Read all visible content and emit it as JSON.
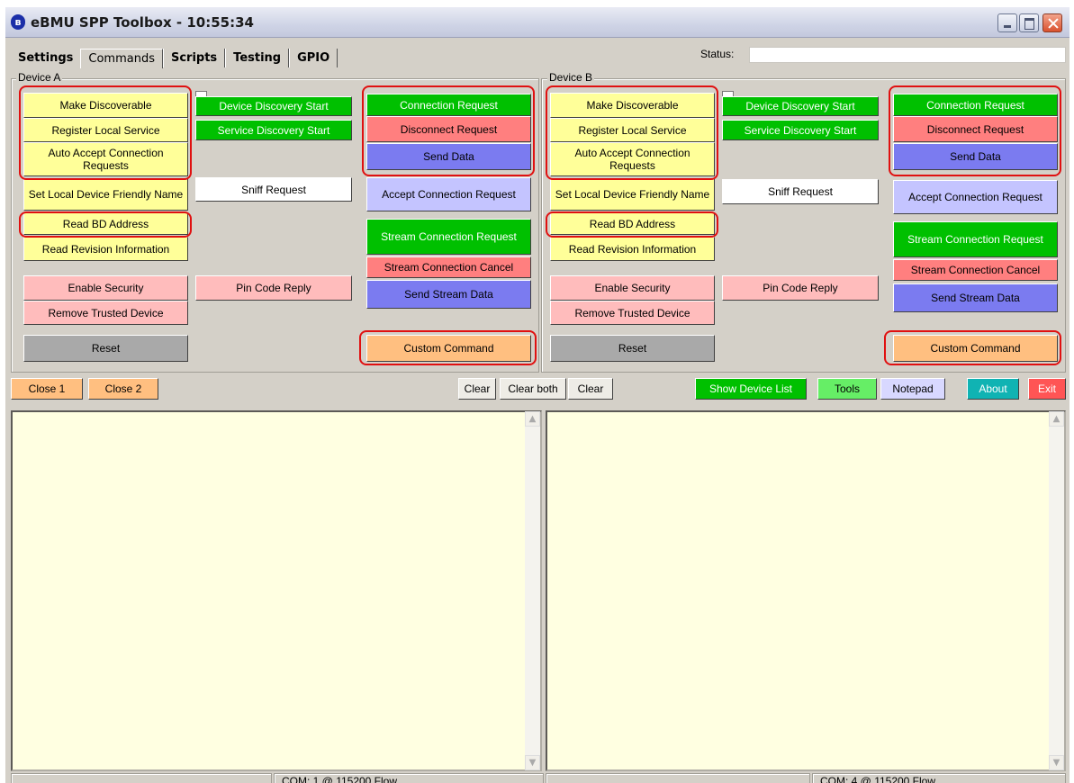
{
  "window": {
    "title": "eBMU SPP Toolbox - 10:55:34"
  },
  "tabs": [
    "Settings",
    "Commands",
    "Scripts",
    "Testing",
    "GPIO"
  ],
  "status": {
    "label": "Status:",
    "value": ""
  },
  "device_a": {
    "label": "Device A",
    "make_discoverable": "Make Discoverable",
    "register_local_service": "Register Local Service",
    "auto_accept": "Auto Accept Connection Requests",
    "set_friendly_name": "Set Local Device Friendly Name",
    "read_bd_address": "Read BD Address",
    "read_revision": "Read Revision Information",
    "enable_security": "Enable Security",
    "remove_trusted": "Remove Trusted Device",
    "reset": "Reset",
    "device_discovery_start": "Device Discovery Start",
    "service_discovery_start": "Service Discovery Start",
    "sniff_request": "Sniff Request",
    "pin_code_reply": "Pin Code Reply",
    "connection_request": "Connection Request",
    "disconnect_request": "Disconnect Request",
    "send_data": "Send Data",
    "accept_connection": "Accept Connection Request",
    "stream_connection_request": "Stream Connection Request",
    "stream_connection_cancel": "Stream Connection Cancel",
    "send_stream_data": "Send Stream Data",
    "custom_command": "Custom Command"
  },
  "device_b": {
    "label": "Device B",
    "make_discoverable": "Make Discoverable",
    "register_local_service": "Register Local Service",
    "auto_accept": "Auto Accept Connection Requests",
    "set_friendly_name": "Set Local Device Friendly Name",
    "read_bd_address": "Read BD Address",
    "read_revision": "Read Revision Information",
    "enable_security": "Enable Security",
    "remove_trusted": "Remove Trusted Device",
    "reset": "Reset",
    "device_discovery_start": "Device Discovery Start",
    "service_discovery_start": "Service Discovery Start",
    "sniff_request": "Sniff Request",
    "pin_code_reply": "Pin Code Reply",
    "connection_request": "Connection Request",
    "disconnect_request": "Disconnect Request",
    "send_data": "Send Data",
    "accept_connection": "Accept Connection Request",
    "stream_connection_request": "Stream Connection Request",
    "stream_connection_cancel": "Stream Connection Cancel",
    "send_stream_data": "Send Stream Data",
    "custom_command": "Custom Command"
  },
  "toolbar": {
    "close1": "Close 1",
    "close2": "Close 2",
    "clear_a": "Clear",
    "clear_both": "Clear both",
    "clear_b": "Clear",
    "show_device_list": "Show Device List",
    "tools": "Tools",
    "notepad": "Notepad",
    "about": "About",
    "exit": "Exit"
  },
  "statusbar": {
    "left_com": "COM: 1 @ 115200 Flow",
    "right_com": "COM: 4 @ 115200 Flow"
  },
  "colors": {
    "yellow": "#ffff99",
    "green": "#00c000",
    "red": "#ff7f7f",
    "blue": "#7b7bf0",
    "orange": "#ffbf80",
    "highlight": "#e01010",
    "log_bg": "#ffffe1"
  }
}
